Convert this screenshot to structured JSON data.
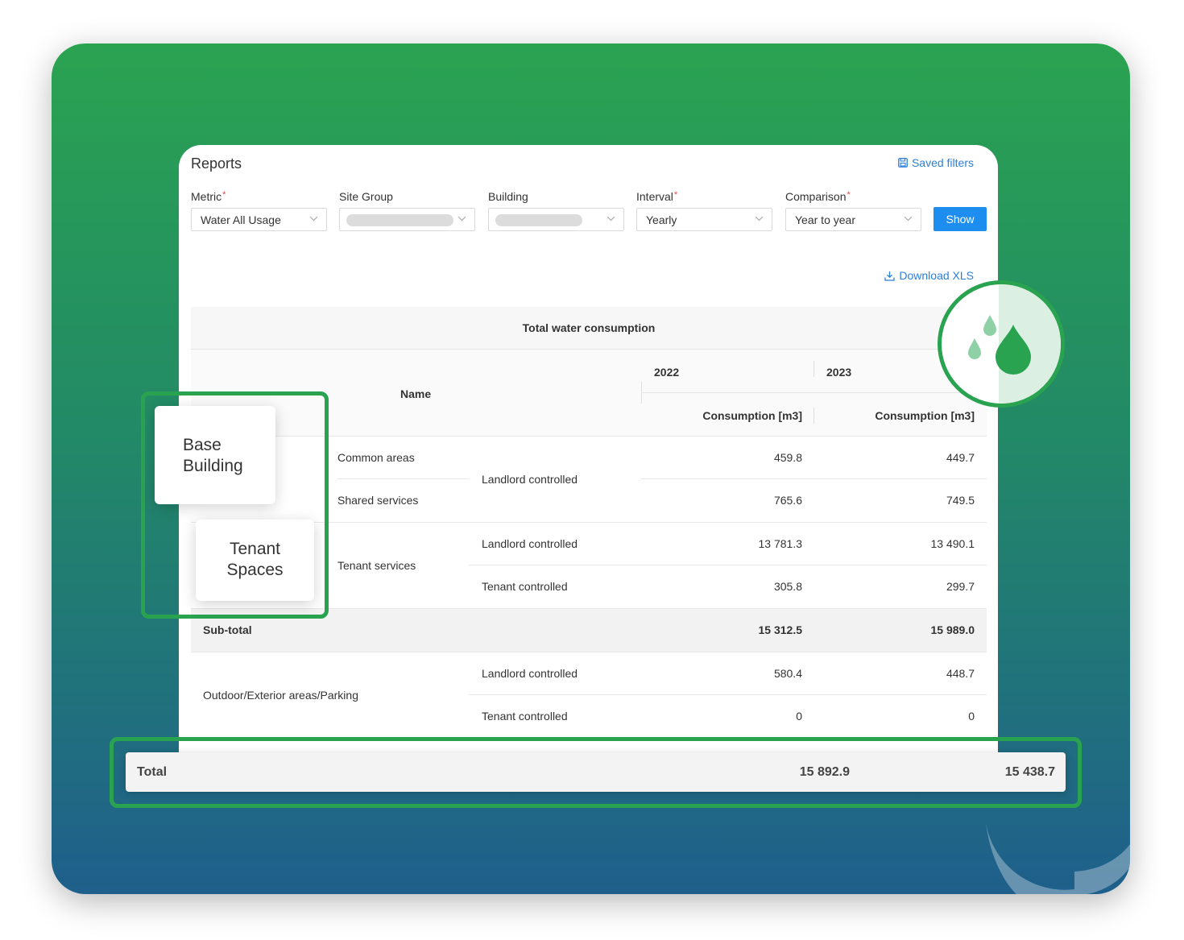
{
  "card": {
    "title": "Reports",
    "saved_filters": "Saved filters",
    "download": "Download XLS",
    "show_label": "Show"
  },
  "filters": [
    {
      "label": "Metric",
      "required": "*",
      "value": "Water All Usage"
    },
    {
      "label": "Site Group",
      "required": "",
      "value": ""
    },
    {
      "label": "Building",
      "required": "",
      "value": ""
    },
    {
      "label": "Interval",
      "required": "*",
      "value": "Yearly"
    },
    {
      "label": "Comparison",
      "required": "*",
      "value": "Year to year"
    }
  ],
  "table": {
    "title": "Total water consumption",
    "name_header": "Name",
    "year_1": "2022",
    "year_2": "2023",
    "unit_header": "Consumption [m3]",
    "rows": [
      {
        "group": "Common areas",
        "control": "",
        "v2022": "459.8",
        "v2023": "449.7"
      },
      {
        "group": "Shared services",
        "control": "",
        "v2022": "765.6",
        "v2023": "749.5"
      },
      {
        "group": "",
        "control": "Landlord controlled",
        "v2022": "13 781.3",
        "v2023": "13 490.1"
      },
      {
        "group": "",
        "control": "Tenant controlled",
        "v2022": "305.8",
        "v2023": "299.7"
      },
      {
        "group": "",
        "control": "Landlord controlled",
        "v2022": "580.4",
        "v2023": "448.7"
      },
      {
        "group": "",
        "control": "Tenant controlled",
        "v2022": "0",
        "v2023": "0"
      }
    ],
    "base_control": "Landlord controlled",
    "tenant_group": "Tenant services",
    "outdoor_group": "Outdoor/Exterior areas/Parking",
    "subtotal": {
      "label": "Sub-total",
      "v2022": "15 312.5",
      "v2023": "15 989.0"
    },
    "total": {
      "label": "Total",
      "v2022": "15 892.9",
      "v2023": "15 438.7"
    }
  },
  "tags": {
    "base_line1": "Base",
    "base_line2": "Building",
    "tenant_line1": "Tenant",
    "tenant_line2": "Spaces"
  },
  "icons": [
    "save-icon",
    "download-icon",
    "chevron-down-icon",
    "water-drops-icon",
    "sprout-icon"
  ],
  "colors": {
    "brand_green": "#2aa351",
    "link_blue": "#2b7fd9",
    "button_blue": "#1d8ef0",
    "required_red": "#e04545"
  }
}
